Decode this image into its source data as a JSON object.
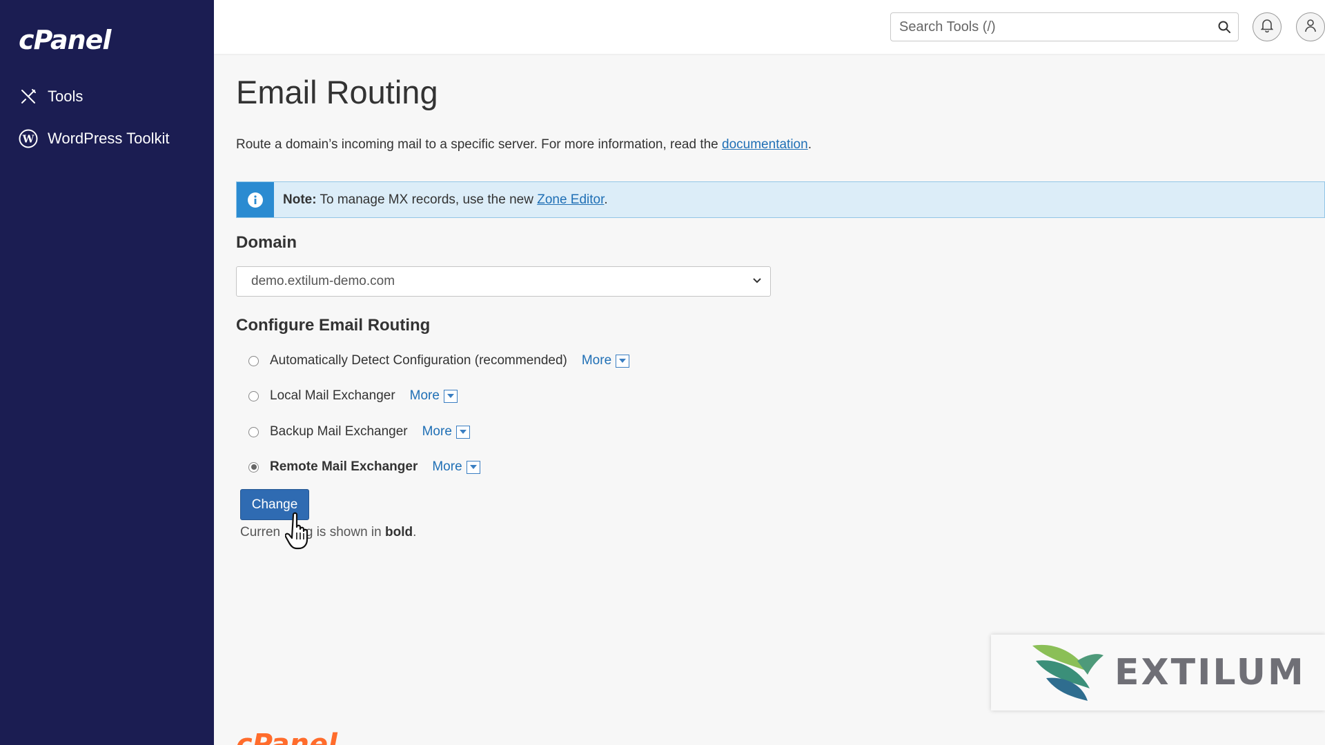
{
  "sidebar": {
    "logo": "cPanel",
    "items": [
      {
        "label": "Tools",
        "icon": "tools-icon"
      },
      {
        "label": "WordPress Toolkit",
        "icon": "wordpress-icon"
      }
    ]
  },
  "header": {
    "search_placeholder": "Search Tools (/)"
  },
  "page": {
    "title": "Email Routing",
    "description": "Route a domain’s incoming mail to a specific server. For more information, read the ",
    "description_link": "documentation",
    "description_end": ".",
    "note_label": "Note:",
    "note_text": " To manage MX records, use the new ",
    "note_link": "Zone Editor",
    "note_end": "."
  },
  "domain": {
    "title": "Domain",
    "selected": "demo.extilum-demo.com"
  },
  "routing": {
    "title": "Configure Email Routing",
    "more_label": "More",
    "options": [
      {
        "label": "Automatically Detect Configuration (recommended)",
        "checked": false
      },
      {
        "label": "Local Mail Exchanger",
        "checked": false
      },
      {
        "label": "Backup Mail Exchanger",
        "checked": false
      },
      {
        "label": "Remote Mail Exchanger",
        "checked": true
      }
    ],
    "change_button": "Change",
    "current_note_prefix": "Curren",
    "current_note_middle": "ing is shown in ",
    "current_note_bold": "bold",
    "current_note_end": "."
  },
  "watermark": {
    "text": "EXTILUM"
  },
  "footer": {
    "logo": "cPanel"
  },
  "colors": {
    "sidebar_bg": "#1b1d52",
    "link": "#1f6fb5",
    "button": "#2f6bb2",
    "note_bg": "#dcedf8",
    "note_icon": "#2b8bd1"
  }
}
